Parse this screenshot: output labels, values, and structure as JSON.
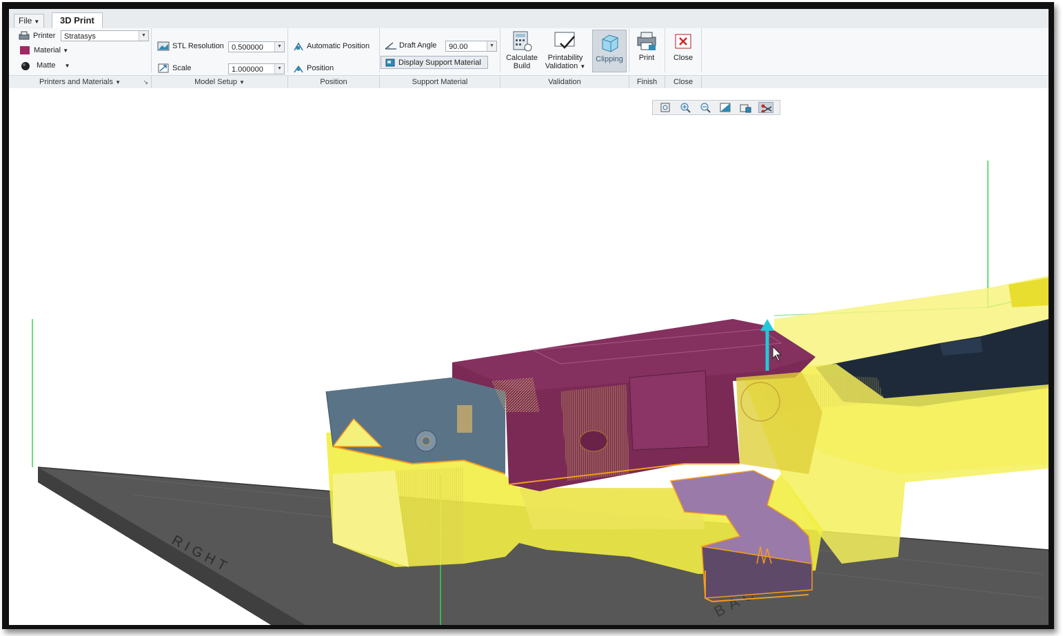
{
  "tabs": {
    "file": "File",
    "active": "3D Print"
  },
  "printers_materials": {
    "printer_label": "Printer",
    "printer_value": "Stratasys",
    "material_label": "Material",
    "finish_label": "Matte",
    "group_label": "Printers and Materials"
  },
  "model_setup": {
    "stl_label": "STL Resolution",
    "stl_value": "0.500000",
    "scale_label": "Scale",
    "scale_value": "1.000000",
    "group_label": "Model Setup"
  },
  "position": {
    "auto_label": "Automatic Position",
    "position_label": "Position",
    "group_label": "Position"
  },
  "support": {
    "draft_label": "Draft Angle",
    "draft_value": "90.00",
    "display_label": "Display Support Material",
    "group_label": "Support Material"
  },
  "validation": {
    "calc_line1": "Calculate",
    "calc_line2": "Build",
    "print_line1": "Printability",
    "print_line2": "Validation",
    "clipping": "Clipping",
    "group_label": "Validation"
  },
  "finish": {
    "print": "Print",
    "group_label": "Finish"
  },
  "close": {
    "close": "Close",
    "group_label": "Close"
  },
  "viewport": {
    "view_tools": [
      "zoom-fit-icon",
      "zoom-in-icon",
      "zoom-out-icon",
      "shading-icon",
      "view-orient-icon",
      "clipping-tool-icon"
    ],
    "floor_label_left": "RIGHT",
    "floor_label_bottom": "BACK"
  },
  "colors": {
    "material_swatch": "#9e2a62",
    "support_yellow": "#f0ee3a",
    "part_magenta": "#7a2a55",
    "part_steel": "#5b7387",
    "part_purple": "#9a7aa8",
    "part_navy": "#1e2a3a",
    "floor": "#575757",
    "envelope_green": "#39d44a",
    "arrow_cyan": "#22c8d8",
    "close_red": "#d42222"
  }
}
